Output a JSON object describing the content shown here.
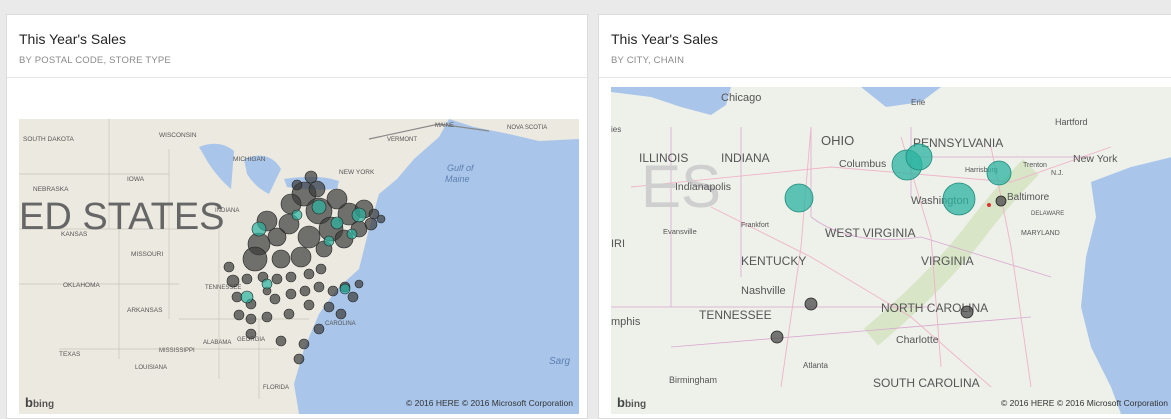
{
  "tiles": [
    {
      "title": "This Year's Sales",
      "subtitle": "BY POSTAL CODE, STORE TYPE",
      "map_labels": {
        "south_dakota": "SOUTH DAKOTA",
        "wisconsin": "WISCONSIN",
        "michigan": "MICHIGAN",
        "iowa": "IOWA",
        "nebraska": "NEBRASKA",
        "united_states": "ED STATES",
        "indiana": "INDIANA",
        "kansas": "KANSAS",
        "missouri": "MISSOURI",
        "oklahoma": "OKLAHOMA",
        "arkansas": "ARKANSAS",
        "tennessee": "TENNESSEE",
        "texas": "TEXAS",
        "mississippi": "MISSISSIPPI",
        "louisiana": "LOUISIANA",
        "alabama": "ALABAMA",
        "georgia": "GEORGIA",
        "florida": "FLORIDA",
        "carolina": "CAROLINA",
        "new_york": "NEW YORK",
        "vermont": "VERMONT",
        "maine": "MAINE",
        "nova_scotia": "NOVA SCOTIA",
        "gulf_line1": "Gulf of",
        "gulf_line2": "Maine",
        "sargasso": "Sarg"
      },
      "credits": "© 2016 HERE   © 2016 Microsoft Corporation",
      "bing": "bing"
    },
    {
      "title": "This Year's Sales",
      "subtitle": "BY CITY, CHAIN",
      "map_labels": {
        "chicago": "Chicago",
        "erie": "Erie",
        "hartford": "Hartford",
        "ohio": "OHIO",
        "pennsylvania": "PENNSYLVANIA",
        "illinois": "ILLINOIS",
        "indiana": "INDIANA",
        "columbus": "Columbus",
        "harrisburg": "Harrisburg",
        "trenton": "Trenton",
        "new_york": "New York",
        "nj": "N.J.",
        "indianapolis": "Indianapolis",
        "washington": "Washington",
        "baltimore": "Baltimore",
        "delaware": "DELAWARE",
        "maryland": "MARYLAND",
        "evansville": "Evansville",
        "frankfort": "Frankfort",
        "west_virginia": "WEST VIRGINIA",
        "iri": "IRI",
        "kentucky": "KENTUCKY",
        "virginia": "VIRGINIA",
        "nashville": "Nashville",
        "north_carolina": "NORTH CAROLINA",
        "emphis": "mphis",
        "tennessee": "TENNESSEE",
        "charlotte": "Charlotte",
        "atlanta": "Atlanta",
        "birmingham": "Birmingham",
        "south_carolina": "SOUTH CAROLINA",
        "es": "ES",
        "ies": "ies"
      },
      "credits": "© 2016 HERE   © 2016 Microsoft Corporation",
      "bing": "bing"
    }
  ],
  "colors": {
    "teal_bubble": "#2bb3a0",
    "dark_bubble": "#3a3a3a",
    "water": "#a9c6ea",
    "land": "#eef0ea"
  },
  "icons": [
    "bing-logo-icon"
  ]
}
